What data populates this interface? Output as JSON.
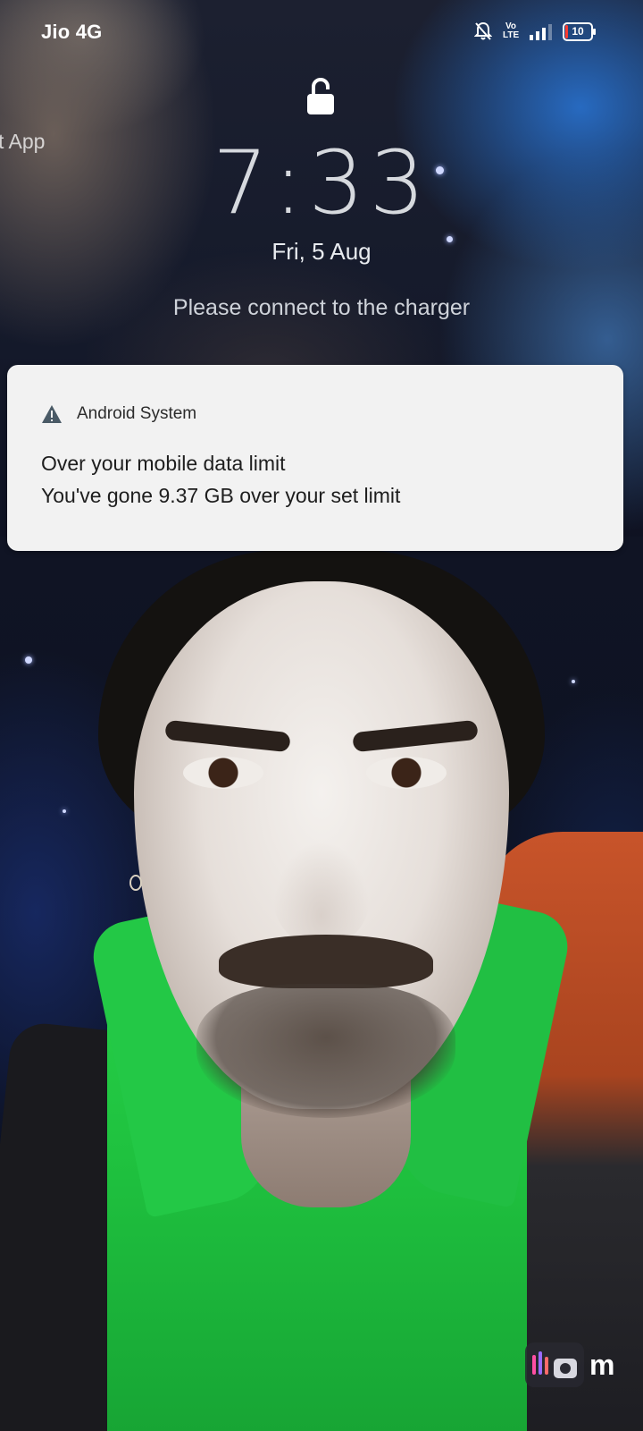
{
  "status_bar": {
    "carrier": "Jio 4G",
    "volte_label": "Vo LTE",
    "battery_level": "10",
    "icons": [
      "mute-bell-icon",
      "volte-icon",
      "signal-icon",
      "battery-icon"
    ]
  },
  "lockscreen": {
    "side_text": "t App",
    "time": "7:33",
    "date": "Fri, 5 Aug",
    "charger_message": "Please connect to the charger"
  },
  "notification": {
    "app_name": "Android System",
    "icon": "warning-icon",
    "title": "Over your mobile data limit",
    "body": "You've gone 9.37 GB over your set limit"
  },
  "watermark": {
    "text": "m"
  },
  "colors": {
    "notification_bg": "#f2f2f2",
    "warning_icon": "#4a5a66",
    "battery_low": "#ff3b30"
  }
}
